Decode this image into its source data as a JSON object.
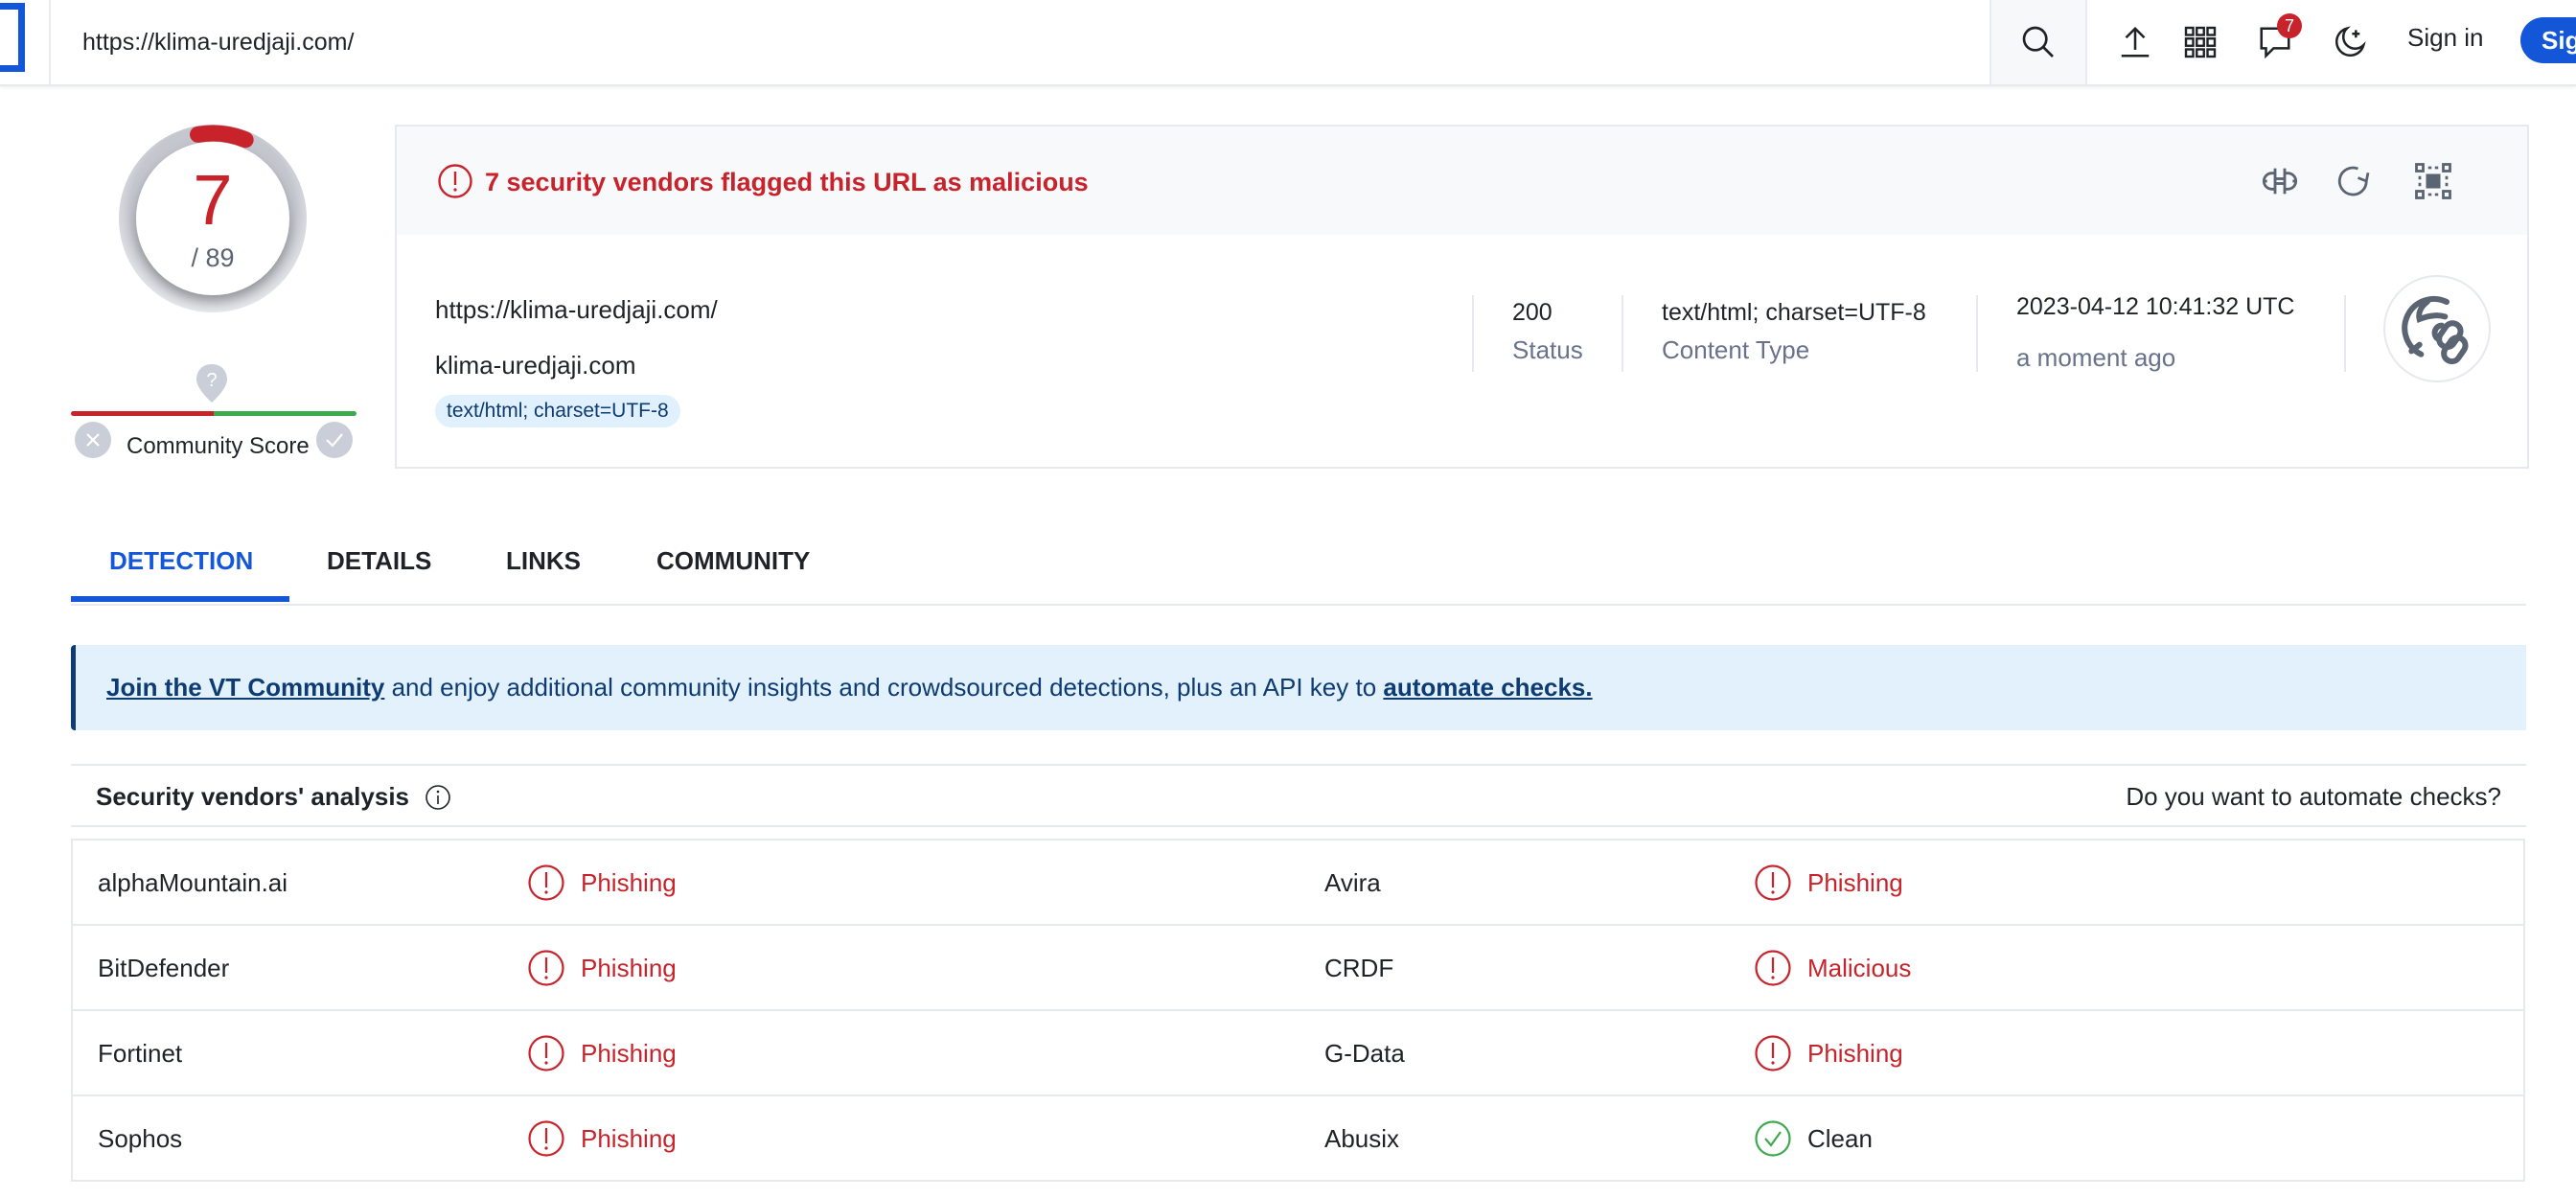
{
  "header": {
    "url_value": "https://klima-uredjaji.com/",
    "notification_count": "7",
    "sign_in_label": "Sign in",
    "sign_up_label": "Sign up",
    "icons": [
      "search-icon",
      "upload-icon",
      "apps-grid-icon",
      "chat-icon",
      "dark-mode-icon"
    ]
  },
  "score": {
    "detections": "7",
    "total": "/ 89",
    "detections_fraction": 0.0787,
    "community_label": "Community Score",
    "community_pin_glyph": "?"
  },
  "alert": {
    "text": "7 security vendors flagged this URL as malicious",
    "tools": [
      "compare-icon",
      "reanalyze-icon",
      "graph-icon"
    ]
  },
  "info": {
    "url": "https://klima-uredjaji.com/",
    "domain": "klima-uredjaji.com",
    "tag": "text/html; charset=UTF-8",
    "status_value": "200",
    "status_label": "Status",
    "content_type_value": "text/html; charset=UTF-8",
    "content_type_label": "Content Type",
    "date_value": "2023-04-12 10:41:32 UTC",
    "date_relative": "a moment ago"
  },
  "tabs": [
    {
      "label": "DETECTION",
      "active": true
    },
    {
      "label": "DETAILS",
      "active": false
    },
    {
      "label": "LINKS",
      "active": false
    },
    {
      "label": "COMMUNITY",
      "active": false
    }
  ],
  "banner": {
    "link1": "Join the VT Community",
    "middle": " and enjoy additional community insights and crowdsourced detections, plus an API key to ",
    "link2": "automate checks."
  },
  "vendors": {
    "title": "Security vendors' analysis",
    "automate_question": "Do you want to automate checks?",
    "rows": [
      {
        "left": {
          "name": "alphaMountain.ai",
          "result": "Phishing",
          "status": "malicious"
        },
        "right": {
          "name": "Avira",
          "result": "Phishing",
          "status": "malicious"
        }
      },
      {
        "left": {
          "name": "BitDefender",
          "result": "Phishing",
          "status": "malicious"
        },
        "right": {
          "name": "CRDF",
          "result": "Malicious",
          "status": "malicious"
        }
      },
      {
        "left": {
          "name": "Fortinet",
          "result": "Phishing",
          "status": "malicious"
        },
        "right": {
          "name": "G-Data",
          "result": "Phishing",
          "status": "malicious"
        }
      },
      {
        "left": {
          "name": "Sophos",
          "result": "Phishing",
          "status": "malicious"
        },
        "right": {
          "name": "Abusix",
          "result": "Clean",
          "status": "clean"
        }
      }
    ]
  },
  "colors": {
    "brand": "#1357d8",
    "malicious": "#c8232b",
    "clean": "#3bab4e",
    "banner_bg": "#e3f1fd",
    "banner_text": "#0d3b73"
  }
}
